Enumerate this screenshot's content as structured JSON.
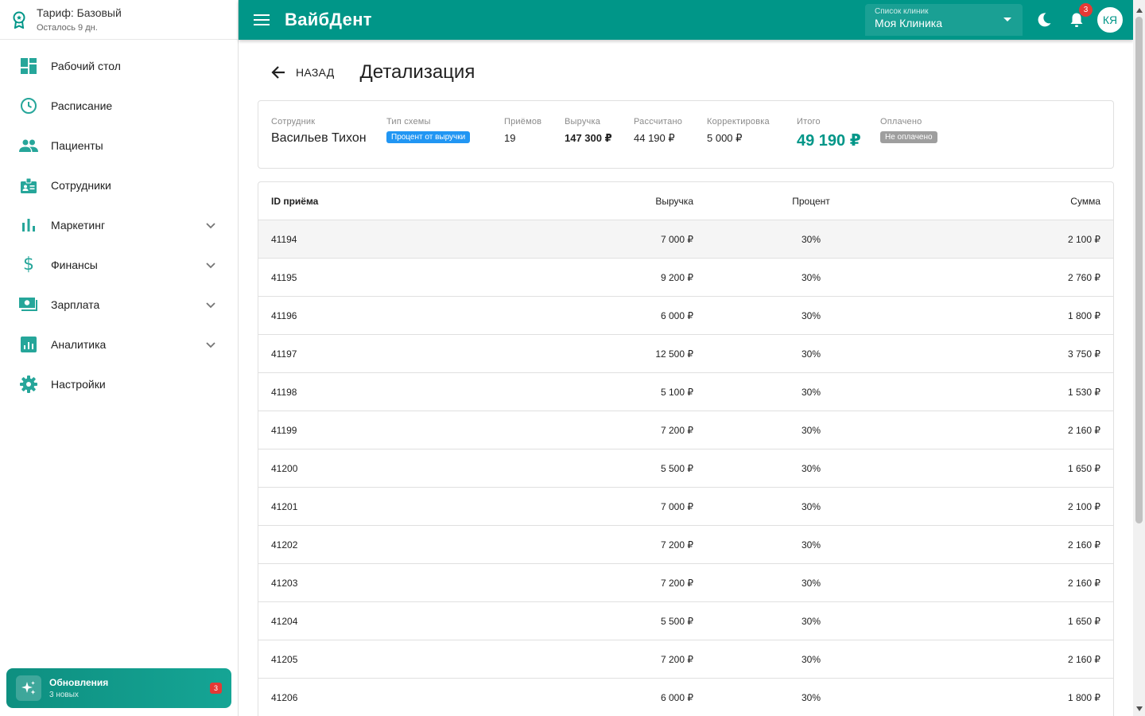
{
  "plan": {
    "title": "Тариф: Базовый",
    "subtitle": "Осталось 9 дн."
  },
  "sidebar": {
    "items": [
      {
        "label": "Рабочий стол"
      },
      {
        "label": "Расписание"
      },
      {
        "label": "Пациенты"
      },
      {
        "label": "Сотрудники"
      },
      {
        "label": "Маркетинг"
      },
      {
        "label": "Финансы"
      },
      {
        "label": "Зарплата"
      },
      {
        "label": "Аналитика"
      },
      {
        "label": "Настройки"
      }
    ]
  },
  "updates": {
    "title": "Обновления",
    "subtitle": "3 новых",
    "badge": "3"
  },
  "topbar": {
    "app_title": "ВайбДент",
    "clinic_label": "Список клиник",
    "clinic_value": "Моя Клиника",
    "notifications": "3",
    "avatar": "КЯ"
  },
  "page": {
    "back_label": "НАЗАД",
    "title": "Детализация"
  },
  "summary": {
    "employee_label": "Сотрудник",
    "employee": "Васильев Тихон",
    "scheme_label": "Тип схемы",
    "scheme": "Процент от выручки",
    "visits_label": "Приёмов",
    "visits": "19",
    "revenue_label": "Выручка",
    "revenue": "147 300 ₽",
    "calculated_label": "Рассчитано",
    "calculated": "44 190 ₽",
    "adjustment_label": "Корректировка",
    "adjustment": "5 000 ₽",
    "total_label": "Итого",
    "total": "49 190 ₽",
    "paid_label": "Оплачено",
    "paid": "Не оплачено"
  },
  "table": {
    "headers": {
      "id": "ID приёма",
      "revenue": "Выручка",
      "percent": "Процент",
      "sum": "Сумма"
    },
    "rows": [
      {
        "id": "41194",
        "revenue": "7 000 ₽",
        "percent": "30%",
        "sum": "2 100 ₽"
      },
      {
        "id": "41195",
        "revenue": "9 200 ₽",
        "percent": "30%",
        "sum": "2 760 ₽"
      },
      {
        "id": "41196",
        "revenue": "6 000 ₽",
        "percent": "30%",
        "sum": "1 800 ₽"
      },
      {
        "id": "41197",
        "revenue": "12 500 ₽",
        "percent": "30%",
        "sum": "3 750 ₽"
      },
      {
        "id": "41198",
        "revenue": "5 100 ₽",
        "percent": "30%",
        "sum": "1 530 ₽"
      },
      {
        "id": "41199",
        "revenue": "7 200 ₽",
        "percent": "30%",
        "sum": "2 160 ₽"
      },
      {
        "id": "41200",
        "revenue": "5 500 ₽",
        "percent": "30%",
        "sum": "1 650 ₽"
      },
      {
        "id": "41201",
        "revenue": "7 000 ₽",
        "percent": "30%",
        "sum": "2 100 ₽"
      },
      {
        "id": "41202",
        "revenue": "7 200 ₽",
        "percent": "30%",
        "sum": "2 160 ₽"
      },
      {
        "id": "41203",
        "revenue": "7 200 ₽",
        "percent": "30%",
        "sum": "2 160 ₽"
      },
      {
        "id": "41204",
        "revenue": "5 500 ₽",
        "percent": "30%",
        "sum": "1 650 ₽"
      },
      {
        "id": "41205",
        "revenue": "7 200 ₽",
        "percent": "30%",
        "sum": "2 160 ₽"
      },
      {
        "id": "41206",
        "revenue": "6 000 ₽",
        "percent": "30%",
        "sum": "1 800 ₽"
      }
    ]
  },
  "colors": {
    "accent": "#009688",
    "badge": "#e53935",
    "chip_blue": "#2196f3",
    "chip_grey": "#9e9e9e"
  },
  "icons": {
    "plan": "award-icon",
    "dashboard": "dashboard-icon",
    "schedule": "clock-icon",
    "patients": "people-icon",
    "staff": "badge-icon",
    "marketing": "bar-chart-icon",
    "finance": "dollar-icon",
    "salary": "money-icon",
    "analytics": "analytics-icon",
    "settings": "gear-icon",
    "updates": "sparkle-icon",
    "menu": "menu-icon",
    "theme": "moon-icon",
    "notifications": "bell-icon",
    "back": "arrow-left-icon"
  }
}
